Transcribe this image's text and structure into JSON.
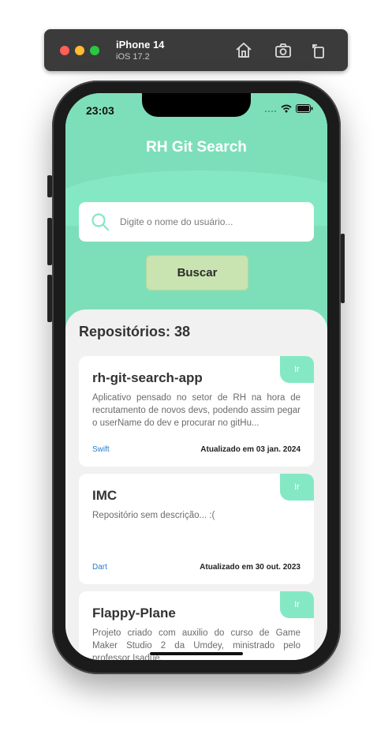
{
  "simulator": {
    "device": "iPhone 14",
    "os": "iOS 17.2"
  },
  "status_bar": {
    "time": "23:03"
  },
  "app": {
    "title": "RH Git Search"
  },
  "search": {
    "placeholder": "Digite o nome do usuário...",
    "value": "",
    "button_label": "Buscar"
  },
  "repos": {
    "count_label": "Repositórios: 38",
    "items": [
      {
        "name": "rh-git-search-app",
        "description": "Aplicativo pensado no setor de RH na hora de recrutamento de novos devs, podendo assim pegar o userName do dev e procurar no gitHu...",
        "language": "Swift",
        "updated": "Atualizado em 03 jan. 2024",
        "go_label": "Ir"
      },
      {
        "name": "IMC",
        "description": "Repositório sem descrição... :(",
        "language": "Dart",
        "updated": "Atualizado em 30 out. 2023",
        "go_label": "Ir"
      },
      {
        "name": "Flappy-Plane",
        "description": "Projeto criado com auxilio do curso de Game Maker Studio 2 da Umdey, ministrado pelo professor Isadue.",
        "language": "",
        "updated": "",
        "go_label": "Ir"
      }
    ]
  },
  "colors": {
    "accent": "#7ddfb9",
    "button": "#c9e3b1",
    "language_link": "#2a7bd1"
  }
}
